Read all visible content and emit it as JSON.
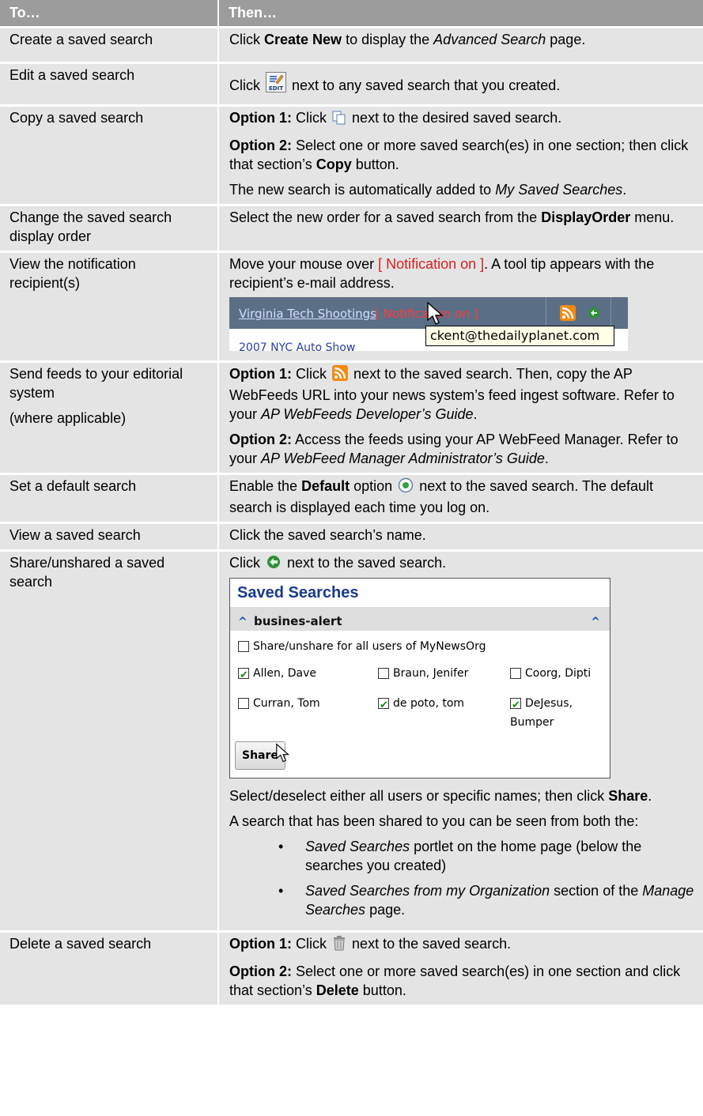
{
  "header": {
    "col1": "To…",
    "col2": "Then…"
  },
  "rows": {
    "create": {
      "to": "Create a saved search",
      "click": "Click",
      "create_new": "Create New",
      "to_display": "to display the",
      "adv": "Advanced Search",
      "page": "page."
    },
    "edit": {
      "to": "Edit a saved search",
      "click": "Click",
      "edit_icon_text": "EDIT",
      "rest": "next to any saved search that you created."
    },
    "copy": {
      "to": "Copy a saved search",
      "opt1": "Option 1:",
      "opt1_click": "Click",
      "opt1_rest": "next to the desired saved search.",
      "opt2": "Option 2:",
      "opt2_a": "Select one or more saved search(es) in one section; then click that section’s",
      "opt2_b": "Copy",
      "opt2_c": "button.",
      "note_a": "The new search is automatically added to",
      "note_b": "My Saved Searches",
      "note_c": "."
    },
    "order": {
      "to": "Change the saved search display order",
      "a": "Select the new order for a saved search from the",
      "b": "DisplayOrder",
      "c": "menu."
    },
    "recipient": {
      "to": "View the notification recipient(s)",
      "a": "Move your mouse over",
      "hl": "[ Notification on ]",
      "b": ". A tool tip appears with the recipient’s e-mail address.",
      "shot_link": "Virginia Tech Shootings",
      "shot_on": "[ Notification on ]",
      "shot_tip": "ckent@thedailyplanet.com",
      "shot_link2": "2007 NYC Auto Show"
    },
    "feeds": {
      "to": "Send feeds to your editorial system",
      "to2": "(where applicable)",
      "opt1": "Option 1:",
      "opt1_click": "Click",
      "opt1_a": "next to the saved search. Then, copy the AP WebFeeds URL into your news system’s feed ingest software. Refer to your",
      "opt1_b": "AP WebFeeds Developer’s Guide",
      "opt1_c": ".",
      "opt2": "Option 2:",
      "opt2_a": "Access the feeds using your AP WebFeed Manager. Refer to your",
      "opt2_b": "AP WebFeed Manager Administrator’s Guide",
      "opt2_c": "."
    },
    "default": {
      "to": "Set a default search",
      "a": "Enable the",
      "b": "Default",
      "c": "option",
      "d": "next to the saved search. The default search is displayed each time you log on."
    },
    "view": {
      "to": "View a saved search",
      "a": "Click the saved search’s name."
    },
    "share": {
      "to": "Share/unshared a saved search",
      "click": "Click",
      "rest": "next to the saved search.",
      "shot": {
        "title": "Saved Searches",
        "group": "busines-alert",
        "all_label": "Share/unshare for all users of MyNewsOrg",
        "users": [
          {
            "name": "Allen, Dave",
            "checked": true
          },
          {
            "name": "Braun, Jenifer",
            "checked": false
          },
          {
            "name": "Coorg, Dipti",
            "checked": false
          },
          {
            "name": "Curran, Tom",
            "checked": false
          },
          {
            "name": "de poto, tom",
            "checked": true
          },
          {
            "name": "DeJesus, Bumper",
            "checked": true
          }
        ],
        "button": "Share"
      },
      "sel_a": "Select/deselect either all users or specific names; then click",
      "sel_b": "Share",
      "sel_c": ".",
      "shared_intro": "A search that has been shared to you can be seen from both the:",
      "b1_a": "Saved Searches",
      "b1_b": "portlet on the home page (below the searches you created)",
      "b2_a": "Saved Searches from my Organization",
      "b2_b": "section of the",
      "b2_c": "Manage Searches",
      "b2_d": "page."
    },
    "delete": {
      "to": "Delete a saved search",
      "opt1": "Option 1:",
      "opt1_click": "Click",
      "opt1_rest": "next to the saved search.",
      "opt2": "Option 2:",
      "opt2_a": "Select one or more saved search(es) in one section and click that section’s",
      "opt2_b": "Delete",
      "opt2_c": "button."
    }
  },
  "colors": {
    "header_bg": "#9c9c9c",
    "cell_bg": "#e4e4e4",
    "highlight": "#d62020",
    "ss_title": "#1a3a8f"
  }
}
